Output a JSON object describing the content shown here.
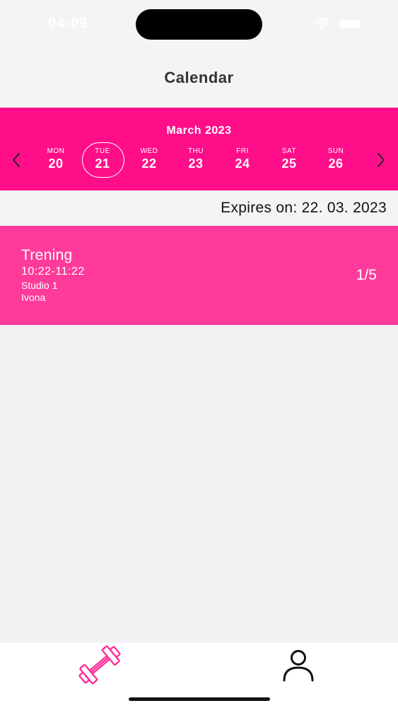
{
  "status_bar": {
    "time": "04:09",
    "icons": [
      "wifi-icon",
      "battery-icon"
    ]
  },
  "header": {
    "title": "Calendar"
  },
  "calendar": {
    "month": "March 2023",
    "prev_icon": "chevron-left-icon",
    "next_icon": "chevron-right-icon",
    "days": [
      {
        "dow": "MON",
        "num": "20",
        "selected": false
      },
      {
        "dow": "TUE",
        "num": "21",
        "selected": true
      },
      {
        "dow": "WED",
        "num": "22",
        "selected": false
      },
      {
        "dow": "THU",
        "num": "23",
        "selected": false
      },
      {
        "dow": "FRI",
        "num": "24",
        "selected": false
      },
      {
        "dow": "SAT",
        "num": "25",
        "selected": false
      },
      {
        "dow": "SUN",
        "num": "26",
        "selected": false
      }
    ]
  },
  "membership": {
    "expires_label": "Expires on: 22. 03. 2023"
  },
  "sessions": [
    {
      "title": "Trening",
      "time": "10:22-11:22",
      "room": "Studio 1",
      "trainer": "Ivona",
      "capacity": "1/5"
    }
  ],
  "tab_bar": {
    "items": [
      {
        "icon": "dumbbell-icon",
        "active": true
      },
      {
        "icon": "profile-icon",
        "active": false
      }
    ]
  },
  "colors": {
    "accent": "#ff0e8a",
    "card": "#fe3b9a",
    "background": "#f2f2f4"
  }
}
